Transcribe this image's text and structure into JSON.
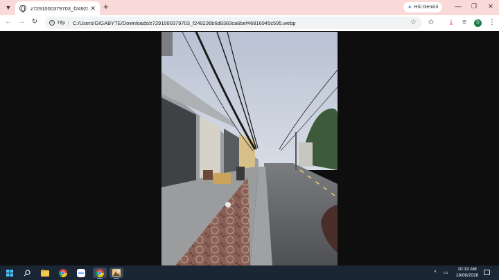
{
  "browser": {
    "tab": {
      "title": "z7291000379703_f249236b6d8383ca6bef46816945c595.webp"
    },
    "gemini_label": "Hỏi Gemini",
    "site_chip": "Tệp",
    "address": "C:/Users/GIGABYTE/Downloads/z7291000379703_f249236b6d8383ca6bef46816945c595.webp",
    "profile_initial": "D",
    "icons": {
      "tab_search": "chevron-down-icon",
      "new_tab": "plus-icon",
      "back": "arrow-left-icon",
      "forward": "arrow-right-icon",
      "reload": "reload-icon",
      "bookmark": "star-icon",
      "extensions": "star-outline-icon",
      "download": "download-icon",
      "reading_list": "reading-list-icon"
    },
    "colors": {
      "tabstrip": "#f9dad9",
      "download_icon": "#d93025",
      "avatar": "#1e7b45"
    }
  },
  "viewer": {
    "image_description": "Street photo: sidewalk with patterned tiles and a row of shophouses on the left, power lines overhead, road with a center line on the right, trees in the distance."
  },
  "taskbar": {
    "apps": [
      "windows-start-icon",
      "search-icon",
      "file-explorer-icon",
      "chrome-icon",
      "zalo-icon",
      "chrome-active-icon",
      "photos-icon"
    ],
    "zalo_label": "Zalo",
    "tray_chevron": "^",
    "time": "10:19 AM",
    "date": "18/06/2026"
  }
}
